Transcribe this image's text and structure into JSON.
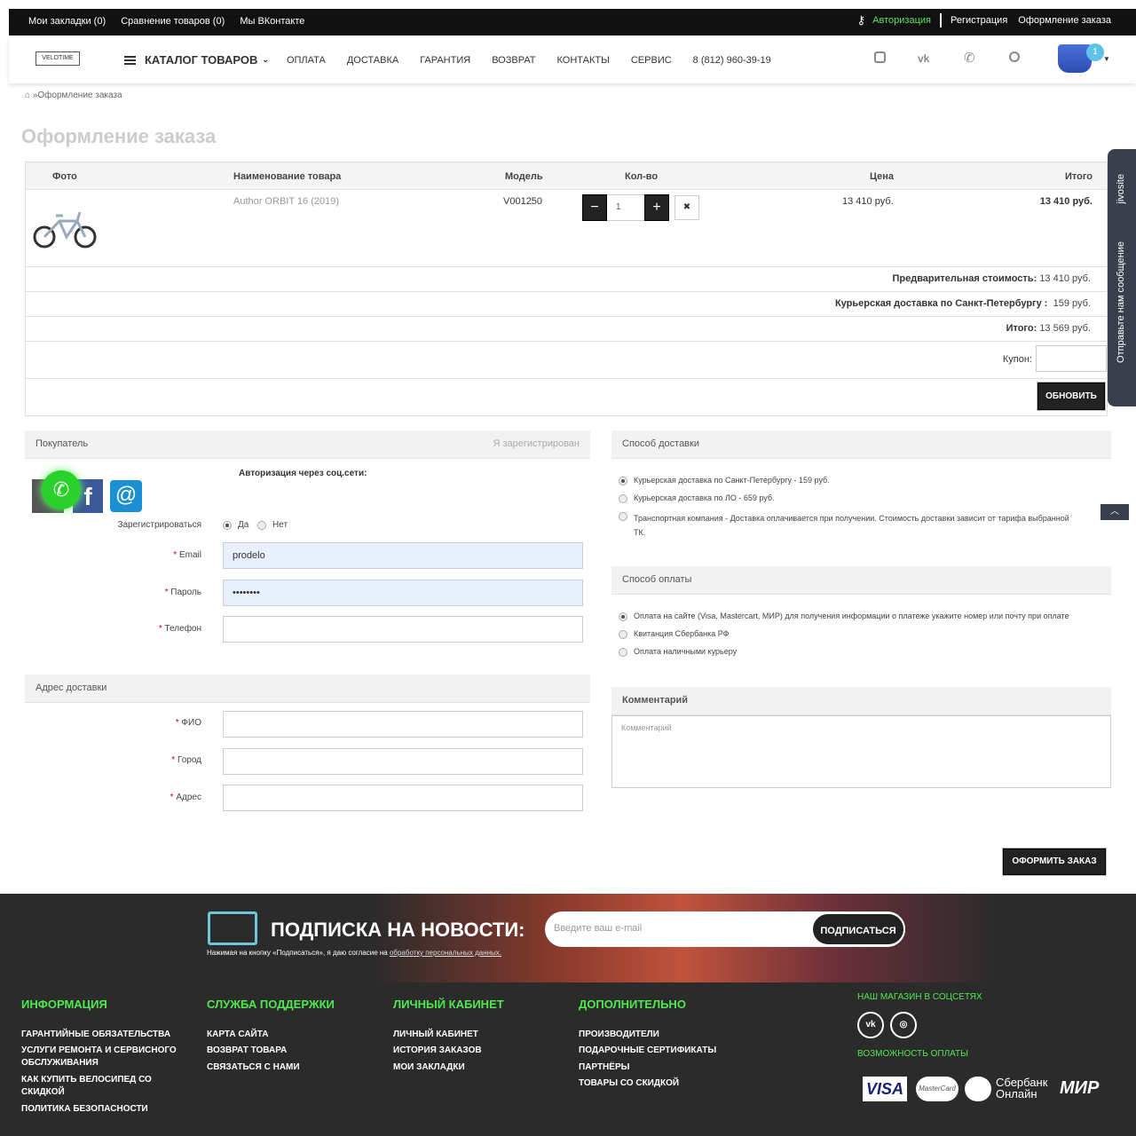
{
  "topbar": {
    "bookmarks": "Мои закладки (0)",
    "compare": "Сравнение товаров (0)",
    "vk": "Мы ВКонтакте",
    "login": "Авторизация",
    "register": "Регистрация",
    "checkout": "Оформление заказа"
  },
  "nav": {
    "logo": "VELOTIME",
    "catalog": "КАТАЛОГ ТОВАРОВ",
    "items": [
      "ОПЛАТА",
      "ДОСТАВКА",
      "ГАРАНТИЯ",
      "ВОЗВРАТ",
      "КОНТАКТЫ",
      "СЕРВИС"
    ],
    "phone": "8 (812) 960-39-19",
    "cart_count": "1"
  },
  "breadcrumb": "»Оформление заказа",
  "title": "Оформление заказа",
  "table": {
    "headers": [
      "Фото",
      "Наименование товара",
      "Модель",
      "Кол-во",
      "Цена",
      "Итого"
    ],
    "item": {
      "name": "Author ORBIT 16 (2019)",
      "model": "V001250",
      "qty": "1",
      "price": "13 410 руб.",
      "total": "13 410 руб."
    },
    "summary": [
      {
        "label": "Предварительная стоимость:",
        "value": "13 410 руб."
      },
      {
        "label": "Курьерская доставка по Санкт-Петербургу :",
        "value": "159 руб."
      },
      {
        "label": "Итого:",
        "value": "13 569 руб."
      }
    ],
    "coupon": "Купон:",
    "update": "ОБНОВИТЬ"
  },
  "buyer": {
    "header": "Покупатель",
    "registered": "Я зарегистрирован",
    "social": "Авторизация через соц.сети:",
    "register_q": "Зарегистрироваться",
    "yes": "Да",
    "no": "Нет",
    "email_label": "Email",
    "email": "prodelo",
    "password_label": "Пароль",
    "password": "••••••••",
    "phone_label": "Телефон"
  },
  "address": {
    "header": "Адрес доставки",
    "fio": "ФИО",
    "city": "Город",
    "addr": "Адрес"
  },
  "delivery": {
    "header": "Способ доставки",
    "options": [
      "Курьерская доставка по Санкт-Петербургу - 159 руб.",
      "Курьерская доставка по ЛО - 659 руб.",
      "Транспортная компания - Доставка оплачивается при получении. Стоимость доставки зависит от тарифа выбранной ТК."
    ]
  },
  "payment": {
    "header": "Способ оплаты",
    "options": [
      "Оплата на сайте (Visa, Mastercart, МИР) для получения информации о платеже укажите номер или почту при оплате",
      "Квитанция Сбербанка РФ",
      "Оплата наличными курьеру"
    ]
  },
  "comment": {
    "header": "Комментарий",
    "placeholder": "Комментарий"
  },
  "submit": "ОФОРМИТЬ ЗАКАЗ",
  "sidetab": {
    "brand": "jivosite",
    "msg": "Отправьте нам сообщение"
  },
  "subscribe": {
    "title": "ПОДПИСКА НА НОВОСТИ:",
    "placeholder": "Введите ваш e-mail",
    "button": "ПОДПИСАТЬСЯ",
    "note": "Нажимая на кнопку «Подписаться», я даю согласие на ",
    "note_link": "обработку персональных данных."
  },
  "footer": {
    "info": {
      "title": "ИНФОРМАЦИЯ",
      "links": [
        "ГАРАНТИЙНЫЕ ОБЯЗАТЕЛЬСТВА",
        "УСЛУГИ РЕМОНТА И СЕРВИСНОГО ОБСЛУЖИВАНИЯ",
        "КАК КУПИТЬ ВЕЛОСИПЕД СО СКИДКОЙ",
        "ПОЛИТИКА БЕЗОПАСНОСТИ"
      ]
    },
    "support": {
      "title": "СЛУЖБА ПОДДЕРЖКИ",
      "links": [
        "КАРТА САЙТА",
        "ВОЗВРАТ ТОВАРА",
        "СВЯЗАТЬСЯ С НАМИ"
      ]
    },
    "account": {
      "title": "ЛИЧНЫЙ КАБИНЕТ",
      "links": [
        "ЛИЧНЫЙ КАБИНЕТ",
        "ИСТОРИЯ ЗАКАЗОВ",
        "МОИ ЗАКЛАДКИ"
      ]
    },
    "extra": {
      "title": "ДОПОЛНИТЕЛЬНО",
      "links": [
        "ПРОИЗВОДИТЕЛИ",
        "ПОДАРОЧНЫЕ СЕРТИФИКАТЫ",
        "ПАРТНЁРЫ",
        "ТОВАРЫ СО СКИДКОЙ"
      ]
    },
    "social_title": "НАШ МАГАЗИН В СОЦСЕТЯХ",
    "pay_title": "ВОЗМОЖНОСТЬ ОПЛАТЫ",
    "pay": [
      "VISA",
      "MasterCard",
      "Сбербанк Онлайн",
      "МИР"
    ]
  }
}
